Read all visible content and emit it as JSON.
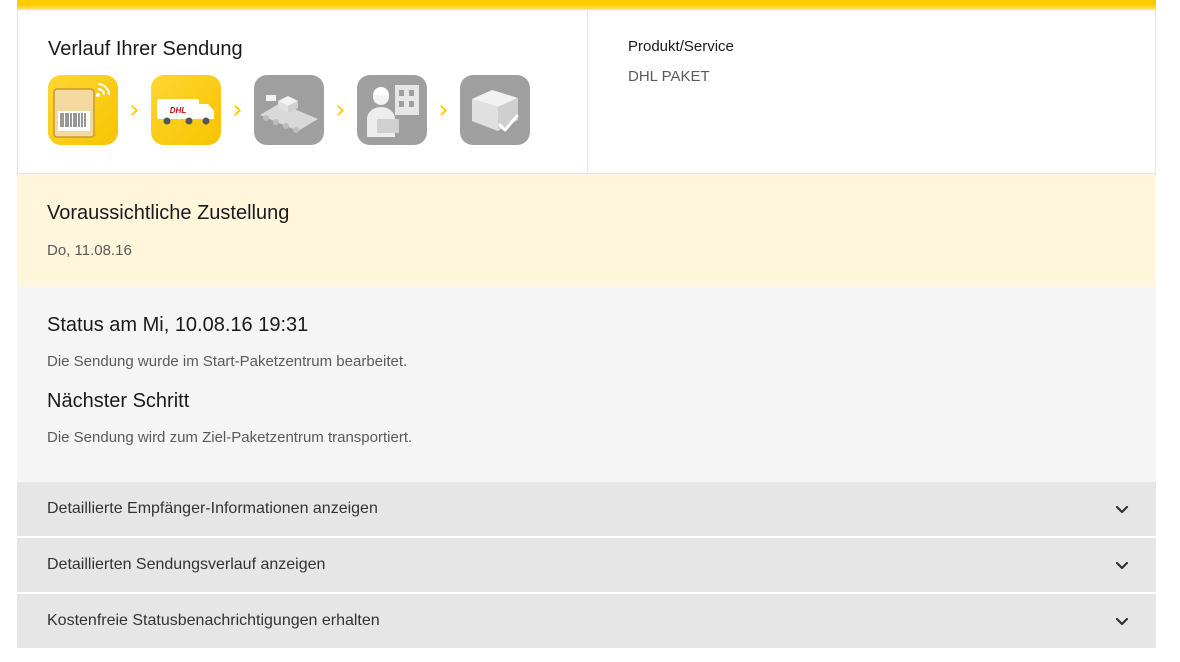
{
  "history": {
    "title": "Verlauf Ihrer Sendung",
    "steps": [
      {
        "icon": "barcode-parcel-icon",
        "state": "done"
      },
      {
        "icon": "dhl-truck-icon",
        "state": "done"
      },
      {
        "icon": "conveyor-belt-icon",
        "state": "pending"
      },
      {
        "icon": "courier-icon",
        "state": "pending"
      },
      {
        "icon": "delivered-parcel-icon",
        "state": "pending"
      }
    ]
  },
  "product": {
    "label": "Produkt/Service",
    "value": "DHL PAKET"
  },
  "delivery": {
    "title": "Voraussichtliche Zustellung",
    "date": "Do, 11.08.16"
  },
  "status": {
    "title": "Status am Mi, 10.08.16 19:31",
    "text": "Die Sendung wurde im Start-Paketzentrum bearbeitet.",
    "next_title": "Nächster Schritt",
    "next_text": "Die Sendung wird zum Ziel-Paketzentrum transportiert."
  },
  "accordions": [
    {
      "label": "Detaillierte Empfänger-Informationen anzeigen"
    },
    {
      "label": "Detaillierten Sendungsverlauf anzeigen"
    },
    {
      "label": "Kostenfreie Statusbenachrichtigungen erhalten"
    }
  ],
  "colors": {
    "accent": "#ffcc00",
    "inactive_step": "#9f9f9f",
    "delivery_bg": "#fff6dc",
    "status_bg": "#f5f5f5",
    "accordion_bg": "#e6e6e6"
  }
}
